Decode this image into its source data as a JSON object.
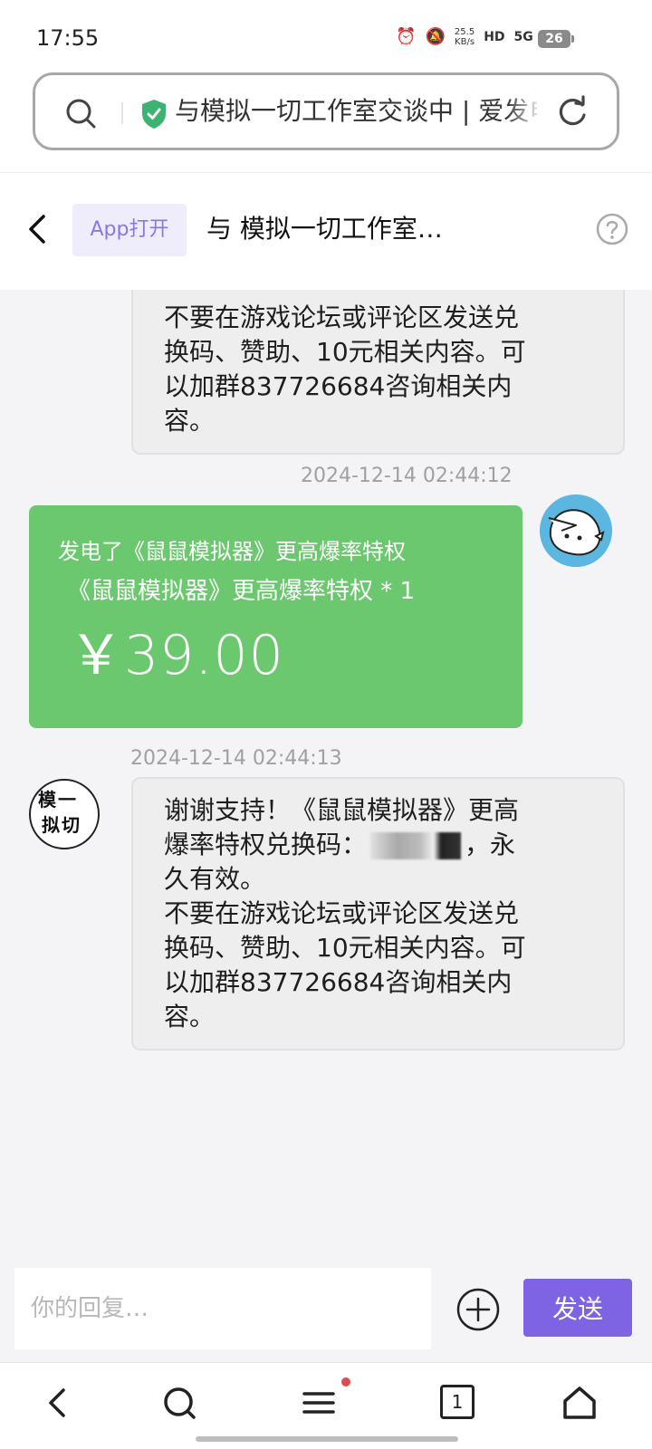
{
  "status_bar": {
    "time": "17:55",
    "net_speed_value": "25.5",
    "net_speed_unit": "KB/s",
    "hd_label": "HD",
    "signal1": "5G",
    "signal2": "5G",
    "battery": "26"
  },
  "address_bar": {
    "text": "与模拟一切工作室交谈中 | 爱发电",
    "secure_color": "#3cb371"
  },
  "header": {
    "app_open_label": "App打开",
    "title": "与 模拟一切工作室…"
  },
  "messages": [
    {
      "lines": [
        "不要在游戏论坛或评论区发送兑",
        "换码、赞助、10元相关内容。可",
        "以加群837726684咨询相关内",
        "容。"
      ]
    },
    {
      "timestamp": "2024-12-14 02:44:12",
      "gift_title": "发电了《鼠鼠模拟器》更高爆率特权",
      "gift_item": "《鼠鼠模拟器》更高爆率特权 * 1",
      "gift_price": "￥39.00"
    },
    {
      "timestamp": "2024-12-14 02:44:13",
      "line1": "谢谢支持！《鼠鼠模拟器》更高",
      "line2_prefix": "爆率特权兑换码：",
      "line2_suffix": "，永",
      "line3": "久有效。",
      "lines_rest": [
        "不要在游戏论坛或评论区发送兑",
        "换码、赞助、10元相关内容。可",
        "以加群837726684咨询相关内",
        "容。"
      ]
    }
  ],
  "avatar_studio": {
    "text_top": "模一",
    "text_bottom": "拟切"
  },
  "reply": {
    "placeholder": "你的回复…",
    "send_label": "发送"
  },
  "bottom_nav": {
    "tabs_count": "1"
  },
  "colors": {
    "accent": "#7e64e3",
    "gift_green": "#6bc86e",
    "app_open_bg": "#efedfc"
  }
}
